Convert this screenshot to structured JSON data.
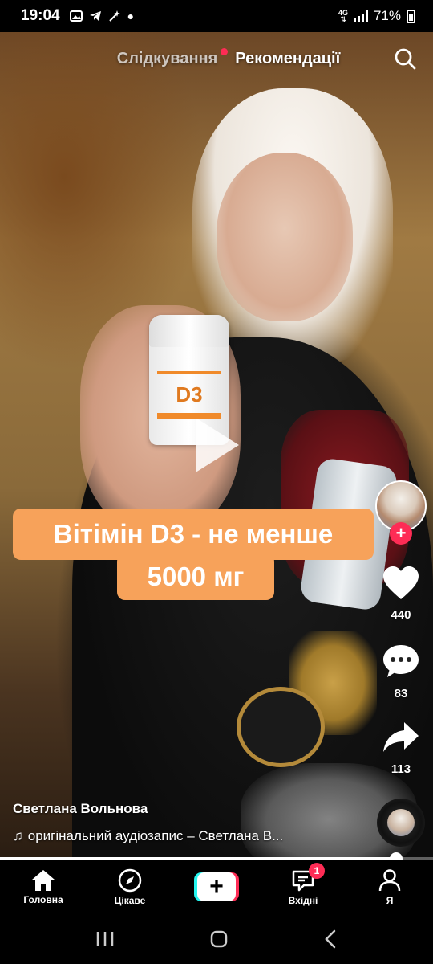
{
  "status_bar": {
    "time": "19:04",
    "network": "4G",
    "battery": "71%"
  },
  "top_tabs": {
    "following": "Слідкування",
    "recommended": "Рекомендації"
  },
  "video": {
    "bottle_label": "D3",
    "caption_line1": "Вітімін D3 - не менше",
    "caption_line2": "5000 мг"
  },
  "actions": {
    "likes": "440",
    "comments": "83",
    "shares": "113"
  },
  "info": {
    "author": "Светлана Вольнова",
    "audio": "оригінальний аудіозапис – Светлана В..."
  },
  "playback": {
    "progress": 0.915
  },
  "bottom_nav": {
    "home": "Головна",
    "discover": "Цікаве",
    "inbox": "Вхідні",
    "inbox_badge": "1",
    "profile": "Я"
  },
  "colors": {
    "accent": "#fe2c55",
    "cyan": "#25f4ee",
    "caption_bg": "#f7a25a"
  }
}
